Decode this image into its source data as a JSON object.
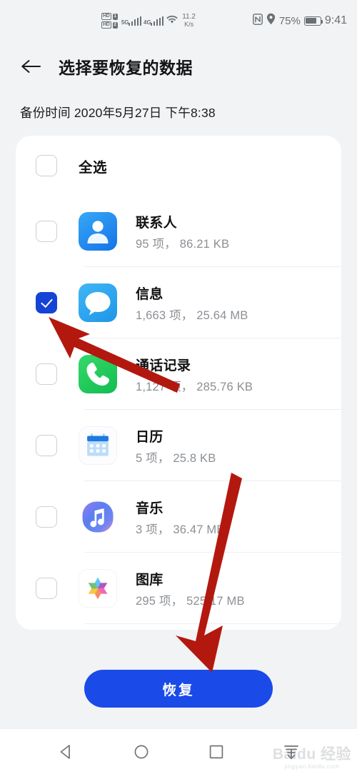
{
  "statusbar": {
    "hd_badge_1": "HD",
    "hd_badge_2": "HD",
    "sim_1": "1",
    "sim_2": "2",
    "network_1": "5G",
    "network_2": "4G",
    "net_speed_value": "11.2",
    "net_speed_unit": "K/s",
    "battery_percent": "75%",
    "clock": "9:41",
    "icons": {
      "nfc": "nfc-icon",
      "location": "location-pin-icon",
      "wifi": "wifi-icon",
      "battery": "battery-icon"
    }
  },
  "appbar": {
    "back_icon": "back-arrow-icon",
    "title": "选择要恢复的数据"
  },
  "backup_time": "备份时间 2020年5月27日 下午8:38",
  "list": {
    "select_all": {
      "label": "全选",
      "checked": false
    },
    "items": [
      {
        "name": "联系人",
        "sub": "95 项，  86.21 KB",
        "checked": false,
        "icon": "contacts-icon",
        "icon_color": "#2196f3"
      },
      {
        "name": "信息",
        "sub": "1,663 项，  25.64 MB",
        "checked": true,
        "icon": "messages-icon",
        "icon_color": "#30a9ee"
      },
      {
        "name": "通话记录",
        "sub": "1,127 项，  285.76 KB",
        "checked": false,
        "icon": "phone-icon",
        "icon_color": "#1ecb5c"
      },
      {
        "name": "日历",
        "sub": "5 项，  25.8 KB",
        "checked": false,
        "icon": "calendar-icon",
        "icon_color": "#2b7fe0"
      },
      {
        "name": "音乐",
        "sub": "3 项，  36.47 MB",
        "checked": false,
        "icon": "music-icon",
        "icon_color": "#5a6df0"
      },
      {
        "name": "图库",
        "sub": "295 项，  525.17 MB",
        "checked": false,
        "icon": "gallery-icon",
        "icon_color": "#f5a623"
      }
    ]
  },
  "restore_button": {
    "label": "恢复",
    "color": "#1a4ae8"
  },
  "navbar": {
    "back": "nav-back-icon",
    "home": "nav-home-icon",
    "recents": "nav-recents-icon",
    "download": "nav-download-icon"
  },
  "watermark": {
    "main": "Baidu 经验",
    "sub": "jingyan.baidu.com"
  },
  "annotations": {
    "arrow_color": "#b3180f",
    "arrow_1_target": "信息-checkbox",
    "arrow_2_target": "恢复-button"
  }
}
